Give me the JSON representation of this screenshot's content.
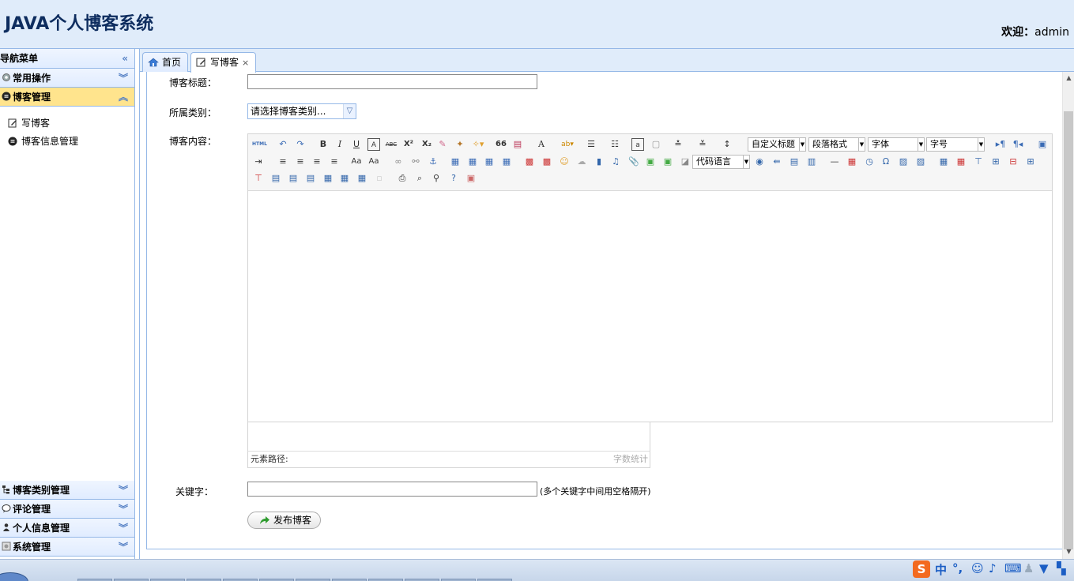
{
  "app_title": "JAVA个人博客系统",
  "welcome": {
    "label": "欢迎：",
    "user": "admin"
  },
  "sidebar": {
    "nav_title": "导航菜单",
    "panels": [
      {
        "label": "常用操作"
      },
      {
        "label": "博客管理"
      }
    ],
    "items": [
      {
        "label": "写博客"
      },
      {
        "label": "博客信息管理"
      }
    ],
    "bottom_panels": [
      {
        "label": "博客类别管理"
      },
      {
        "label": "评论管理"
      },
      {
        "label": "个人信息管理"
      },
      {
        "label": "系统管理"
      }
    ]
  },
  "tabs": [
    {
      "label": "首页"
    },
    {
      "label": "写博客",
      "close": "×"
    }
  ],
  "form": {
    "title_label": "博客标题：",
    "title_value": "",
    "category_label": "所属类别：",
    "category_value": "请选择博客类别...",
    "content_label": "博客内容：",
    "keyword_label": "关键字：",
    "keyword_value": "",
    "keyword_hint": "(多个关键字中间用空格隔开)",
    "submit_label": "发布博客"
  },
  "editor": {
    "dropdowns": {
      "custom_heading": "自定义标题",
      "paragraph": "段落格式",
      "font": "字体",
      "font_size": "字号",
      "code_lang": "代码语言"
    },
    "toolbar_glyphs": {
      "html": "HTML",
      "bold": "B",
      "italic": "I",
      "underline": "U",
      "strike": "ABC",
      "sup": "X²",
      "sub": "X₂",
      "quote": "66",
      "fontcolor": "A",
      "omega": "Ω",
      "hr": "—"
    },
    "path_label": "元素路径:",
    "word_count": "字数统计"
  },
  "taskbar_tray": {
    "lang": "中",
    "punct": "°,"
  },
  "colors": {
    "header_bg": "#e0ecfa",
    "border": "#95b8e7",
    "selected_panel": "#ffe48d",
    "title": "#0e2d5f"
  }
}
